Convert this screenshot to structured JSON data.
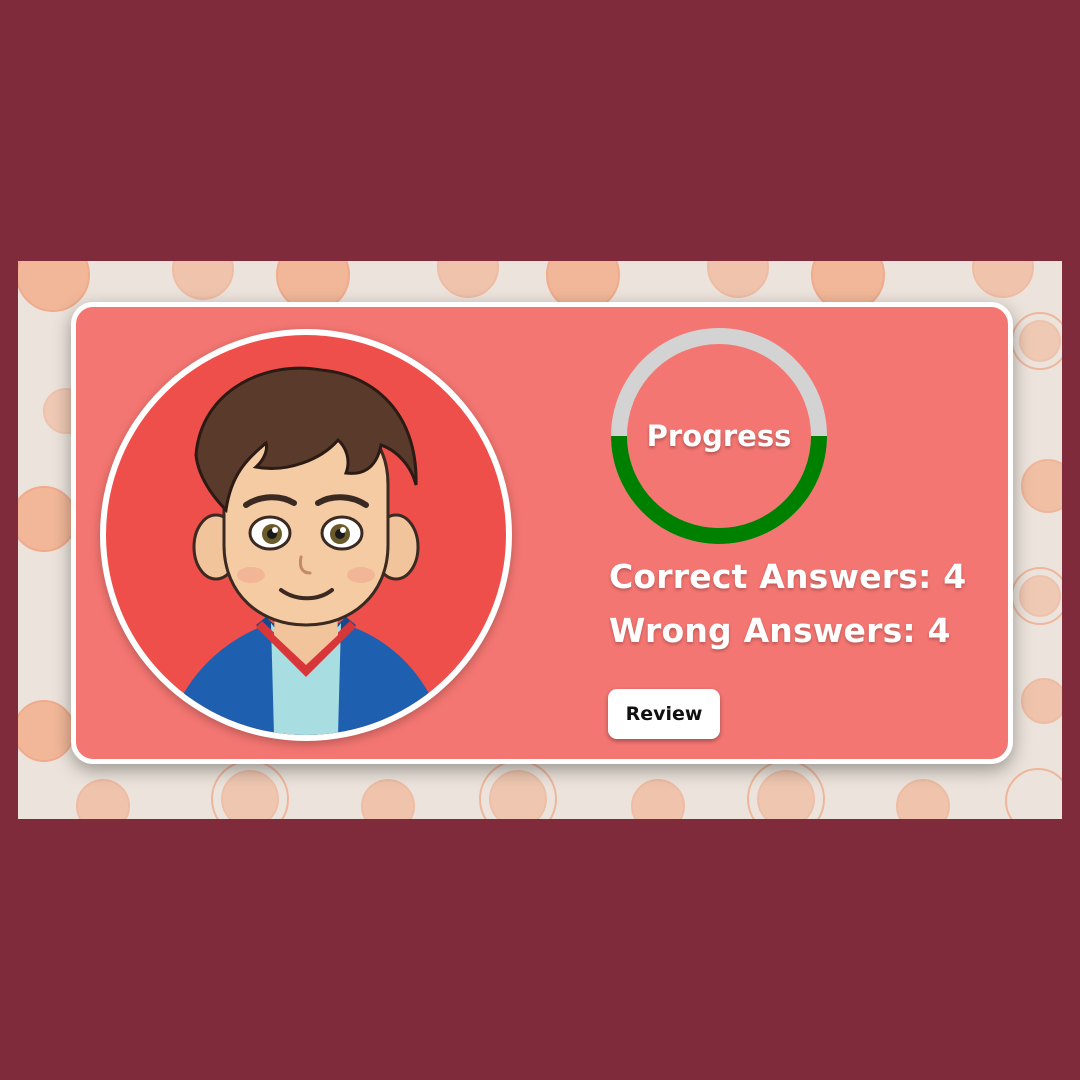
{
  "colors": {
    "page_border": "#7f2b3c",
    "backdrop": "#ece4dc",
    "card": "#f47672",
    "card_border": "#ffffff",
    "avatar_bg": "#ee4f4b",
    "progress_track": "#d3d3d3",
    "progress_fill": "#008000",
    "text": "#ffffff",
    "button_bg": "#ffffff",
    "button_text": "#111111"
  },
  "background": {
    "pattern_icon": "orange-slice-pattern"
  },
  "avatar": {
    "icon": "boy-avatar-illustration"
  },
  "progress": {
    "label": "Progress",
    "fill_fraction": 0.5
  },
  "stats": {
    "correct": "Correct Answers: 4",
    "wrong": "Wrong Answers: 4"
  },
  "actions": {
    "review_label": "Review"
  }
}
